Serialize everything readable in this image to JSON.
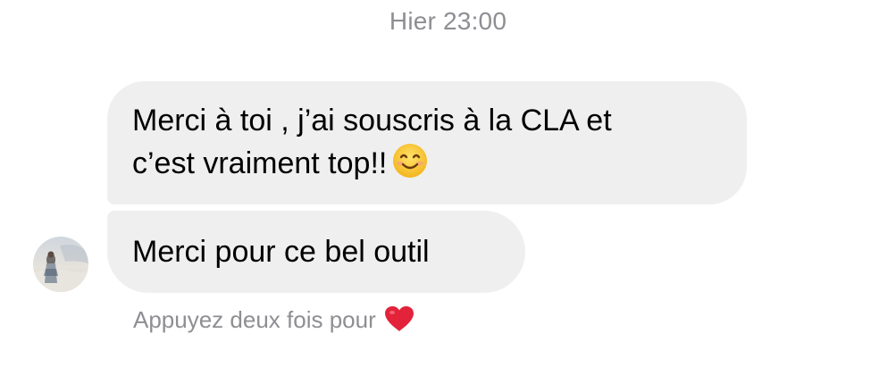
{
  "conversation": {
    "timestamp": "Hier 23:00",
    "messages": [
      {
        "lines": [
          "Merci à toi , j’ai souscris à la CLA et",
          "c’est vraiment top!!"
        ],
        "emoji": "smiling-face-icon"
      },
      {
        "lines": [
          "Merci pour ce bel outil"
        ]
      }
    ],
    "avatar_icon": "contact-avatar-photo",
    "hint_text": "Appuyez deux fois pour",
    "hint_icon": "heart-icon"
  },
  "colors": {
    "bubble_background": "#efefef",
    "meta_text": "#8e8e93",
    "heart": "#e2233a",
    "emoji_yellow": "#f7c52a"
  }
}
